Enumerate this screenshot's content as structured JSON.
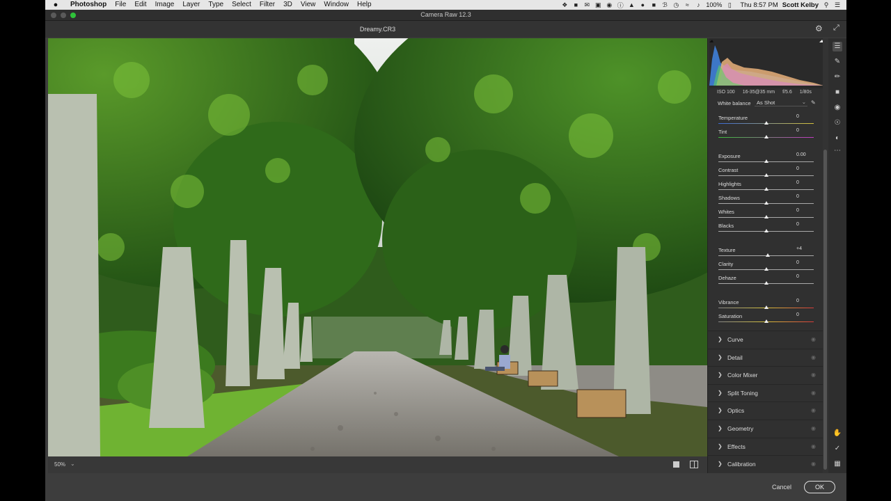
{
  "menubar": {
    "apple_icon": "apple-logo",
    "app_name": "Photoshop",
    "menus": [
      "File",
      "Edit",
      "Image",
      "Layer",
      "Type",
      "Select",
      "Filter",
      "3D",
      "View",
      "Window",
      "Help"
    ],
    "battery": "100%",
    "clock": "Thu 8:57 PM",
    "user": "Scott Kelby"
  },
  "window": {
    "title": "Camera Raw 12.3",
    "filename": "Dreamy.CR3"
  },
  "camera_info": {
    "iso": "ISO 100",
    "lens": "16-35@35 mm",
    "aperture": "f/5.6",
    "shutter": "1/80s"
  },
  "white_balance": {
    "label": "White balance",
    "value": "As Shot"
  },
  "sliders": [
    {
      "label": "Temperature",
      "value": "0",
      "position": 0.5
    },
    {
      "label": "Tint",
      "value": "0",
      "position": 0.5
    },
    {
      "label": "Exposure",
      "value": "0.00",
      "position": 0.5
    },
    {
      "label": "Contrast",
      "value": "0",
      "position": 0.5
    },
    {
      "label": "Highlights",
      "value": "0",
      "position": 0.5
    },
    {
      "label": "Shadows",
      "value": "0",
      "position": 0.5
    },
    {
      "label": "Whites",
      "value": "0",
      "position": 0.5
    },
    {
      "label": "Blacks",
      "value": "0",
      "position": 0.5
    },
    {
      "label": "Texture",
      "value": "+4",
      "position": 0.52
    },
    {
      "label": "Clarity",
      "value": "0",
      "position": 0.5
    },
    {
      "label": "Dehaze",
      "value": "0",
      "position": 0.5
    },
    {
      "label": "Vibrance",
      "value": "0",
      "position": 0.5
    },
    {
      "label": "Saturation",
      "value": "0",
      "position": 0.5
    }
  ],
  "sections": [
    "Curve",
    "Detail",
    "Color Mixer",
    "Split Toning",
    "Optics",
    "Geometry",
    "Effects",
    "Calibration"
  ],
  "zoom": "50%",
  "buttons": {
    "cancel": "Cancel",
    "ok": "OK"
  },
  "colors": {
    "panel_bg": "#303030",
    "app_bg": "#3d3d3d",
    "accent_green": "#2fc23a"
  }
}
